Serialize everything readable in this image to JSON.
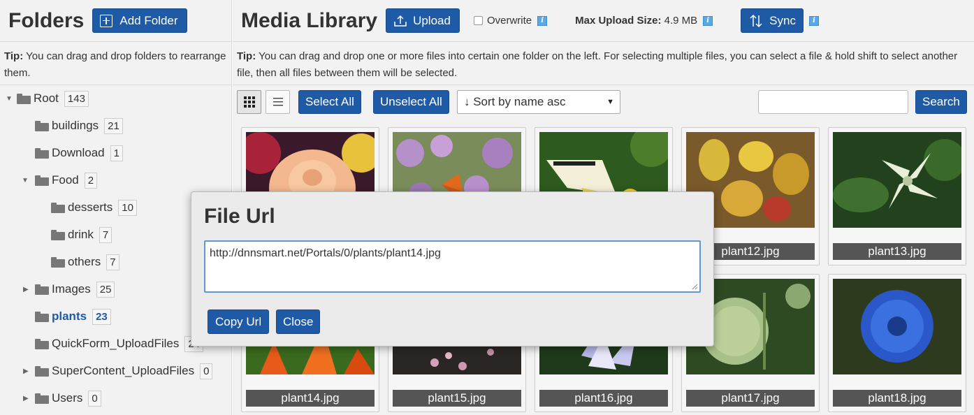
{
  "folders_panel": {
    "title": "Folders",
    "add_folder_label": "Add Folder",
    "tip_label": "Tip:",
    "tip_text": " You can drag and drop folders to rearrange them.",
    "tree": [
      {
        "label": "Root",
        "count": "143",
        "expander": "expanded"
      },
      {
        "label": "buildings",
        "count": "21",
        "expander": "none"
      },
      {
        "label": "Download",
        "count": "1",
        "expander": "none"
      },
      {
        "label": "Food",
        "count": "2",
        "expander": "expanded"
      },
      {
        "label": "desserts",
        "count": "10",
        "expander": "none"
      },
      {
        "label": "drink",
        "count": "7",
        "expander": "none"
      },
      {
        "label": "others",
        "count": "7",
        "expander": "none"
      },
      {
        "label": "Images",
        "count": "25",
        "expander": "collapsed"
      },
      {
        "label": "plants",
        "count": "23",
        "expander": "none",
        "active": true
      },
      {
        "label": "QuickForm_UploadFiles",
        "count": "24",
        "expander": "none"
      },
      {
        "label": "SuperContent_UploadFiles",
        "count": "0",
        "expander": "collapsed"
      },
      {
        "label": "Users",
        "count": "0",
        "expander": "collapsed"
      }
    ]
  },
  "media_panel": {
    "title": "Media Library",
    "upload_label": "Upload",
    "overwrite_label": "Overwrite",
    "overwrite_checked": false,
    "max_upload_label": "Max Upload Size:",
    "max_upload_value": " 4.9 MB",
    "sync_label": "Sync",
    "info_icon": "info-icon",
    "tip_label": "Tip:",
    "tip_text": " You can drag and drop one or more files into certain one folder on the left. For selecting multiple files, you can select a file & hold shift to select another file, then all files between them will be selected.",
    "select_all_label": "Select All",
    "unselect_all_label": "Unselect All",
    "sort_value": "↓ Sort by name asc",
    "search_value": "",
    "search_label": "Search"
  },
  "files": [
    {
      "name": "",
      "image": "peach rose"
    },
    {
      "name": "",
      "image": "butterfly on purple flowers"
    },
    {
      "name": "",
      "image": "yellow butterfly"
    },
    {
      "name": "plant12.jpg",
      "image": "yellow-red leaves"
    },
    {
      "name": "plant13.jpg",
      "image": "white dogwood flower"
    },
    {
      "name": "plant14.jpg",
      "image": "orange lilies"
    },
    {
      "name": "plant15.jpg",
      "image": "pink flowers on dark"
    },
    {
      "name": "plant16.jpg",
      "image": "blue-white flower"
    },
    {
      "name": "plant17.jpg",
      "image": "green globe thistle"
    },
    {
      "name": "plant18.jpg",
      "image": "blue cornflower"
    }
  ],
  "modal": {
    "title": "File Url",
    "url_value": "http://dnnsmart.net/Portals/0/plants/plant14.jpg",
    "copy_label": "Copy Url",
    "close_label": "Close"
  },
  "colors": {
    "primary": "#1f5aa6",
    "panel_bg": "#f2f2f2",
    "active_folder": "#1f5aa6",
    "caption_bg": "#555555"
  }
}
